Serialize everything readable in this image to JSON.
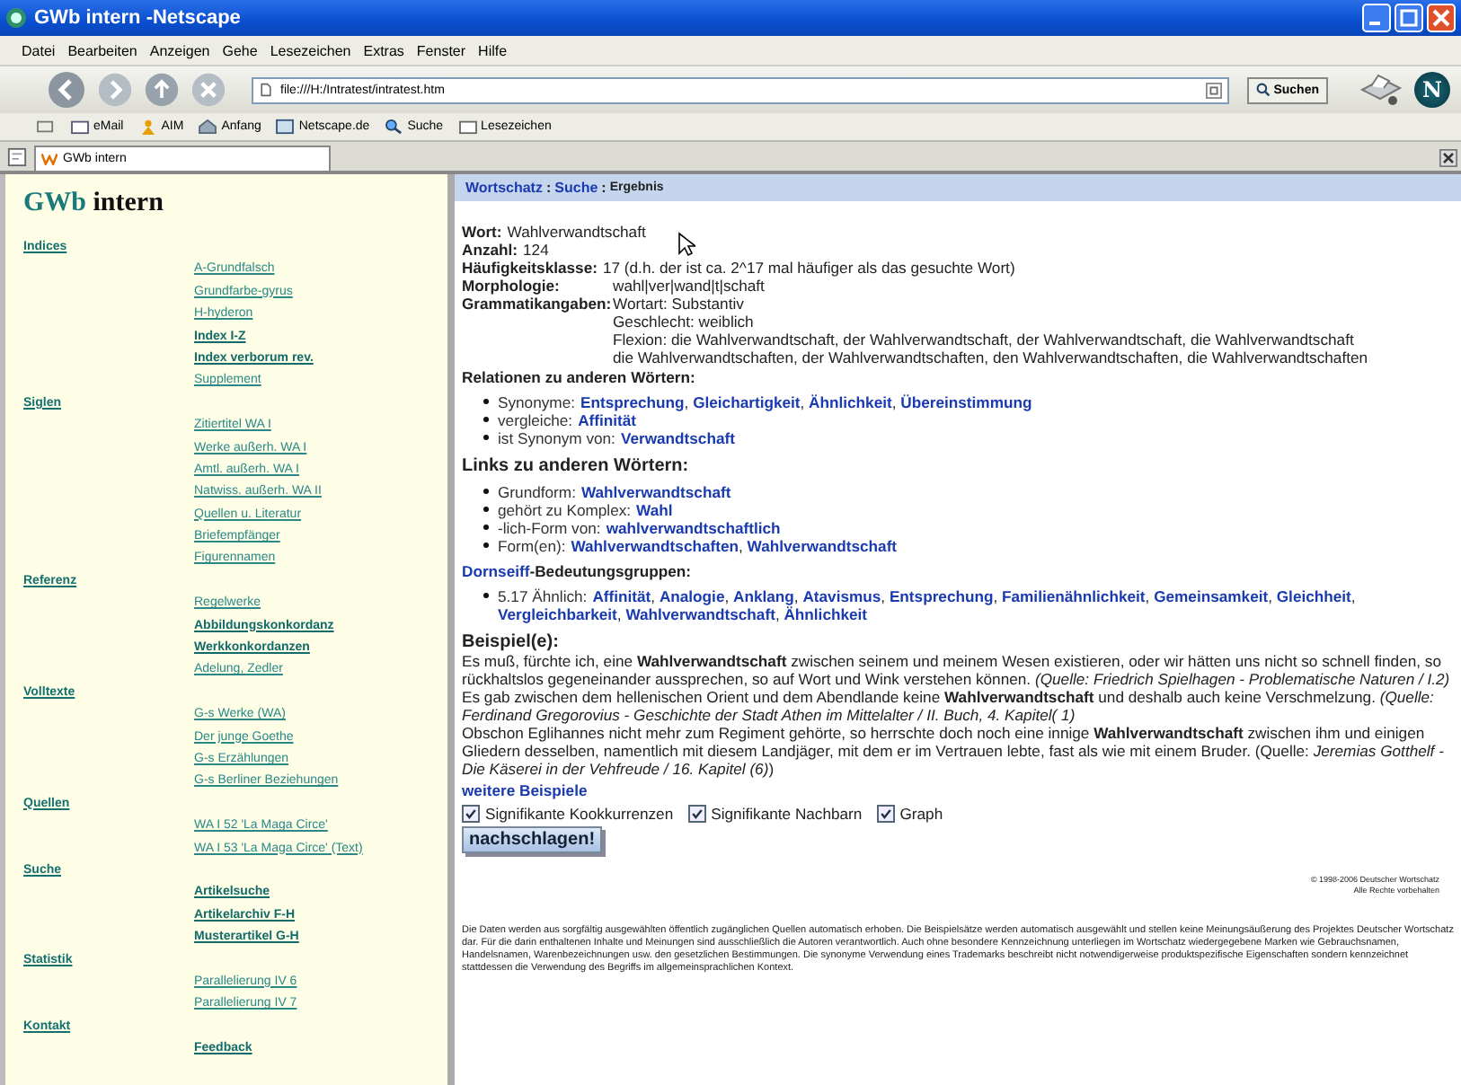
{
  "window": {
    "title": "GWb intern -Netscape"
  },
  "menu": [
    "Datei",
    "Bearbeiten",
    "Anzeigen",
    "Gehe",
    "Lesezeichen",
    "Extras",
    "Fenster",
    "Hilfe"
  ],
  "navigation": {
    "url": "file:///H:/Intratest/intratest.htm",
    "search_button": "Suchen",
    "logo_letter": "N"
  },
  "bookmarks": [
    {
      "label": "eMail",
      "kind": "mail"
    },
    {
      "label": "AIM",
      "kind": "person"
    },
    {
      "label": "Anfang",
      "kind": "home"
    },
    {
      "label": "Netscape.de",
      "kind": "page"
    },
    {
      "label": "Suche",
      "kind": "search"
    },
    {
      "label": "Lesezeichen",
      "kind": "folder"
    }
  ],
  "tab": {
    "label": "GWb intern"
  },
  "sidebar": {
    "logo_a": "GWb",
    "logo_b": "intern",
    "sections": [
      {
        "heading": "Indices",
        "links": [
          {
            "text": "A-Grundfalsch",
            "bold": false
          },
          {
            "text": "Grundfarbe-gyrus",
            "bold": false
          },
          {
            "text": "H-hyderon",
            "bold": false
          },
          {
            "text": "Index I-Z",
            "bold": true
          },
          {
            "text": "Index verborum rev.",
            "bold": true
          },
          {
            "text": "Supplement",
            "bold": false
          }
        ]
      },
      {
        "heading": "Siglen",
        "links": [
          {
            "text": "Zitiertitel WA I",
            "bold": false
          },
          {
            "text": "Werke außerh. WA I",
            "bold": false
          },
          {
            "text": "Amtl. außerh. WA I",
            "bold": false
          },
          {
            "text": "Natwiss. außerh. WA II",
            "bold": false
          },
          {
            "text": "Quellen u. Literatur",
            "bold": false
          },
          {
            "text": "Briefempfänger",
            "bold": false
          },
          {
            "text": "Figurennamen",
            "bold": false
          }
        ]
      },
      {
        "heading": "Referenz",
        "links": [
          {
            "text": "Regelwerke",
            "bold": false
          },
          {
            "text": "Abbildungskonkordanz",
            "bold": true
          },
          {
            "text": "Werkkonkordanzen",
            "bold": true
          },
          {
            "text": "Adelung, Zedler",
            "bold": false
          }
        ]
      },
      {
        "heading": "Volltexte",
        "links": [
          {
            "text": "G-s Werke (WA)",
            "bold": false
          },
          {
            "text": "Der junge Goethe",
            "bold": false
          },
          {
            "text": "G-s Erzählungen",
            "bold": false
          },
          {
            "text": "G-s Berliner Beziehungen",
            "bold": false
          }
        ]
      },
      {
        "heading": "Quellen",
        "links": [
          {
            "text": "WA I 52 'La Maga Circe'",
            "bold": false
          },
          {
            "text": "WA I 53 'La Maga Circe' (Text)",
            "bold": false
          }
        ]
      },
      {
        "heading": "Suche",
        "links": [
          {
            "text": "Artikelsuche",
            "bold": true
          },
          {
            "text": "Artikelarchiv F-H",
            "bold": true
          },
          {
            "text": "Musterartikel G-H",
            "bold": true
          }
        ]
      },
      {
        "heading": "Statistik",
        "links": [
          {
            "text": "Parallelierung IV 6",
            "bold": false
          },
          {
            "text": "Parallelierung IV 7",
            "bold": false
          }
        ]
      },
      {
        "heading": "Kontakt",
        "links": [
          {
            "text": "Feedback",
            "bold": true
          }
        ]
      }
    ]
  },
  "breadcrumb": {
    "separator": ":",
    "items": [
      {
        "label": "Wortschatz",
        "current": false
      },
      {
        "label": "Suche",
        "current": false
      },
      {
        "label": "Ergebnis",
        "current": true
      }
    ]
  },
  "word_info": [
    {
      "label": "Wort:",
      "kind": "inline",
      "values": [
        "Wahlverwandtschaft"
      ]
    },
    {
      "label": "Anzahl:",
      "kind": "inline",
      "values": [
        "124"
      ]
    },
    {
      "label": "Häufigkeitsklasse:",
      "kind": "inline",
      "values": [
        "17 (d.h. der ist ca. 2^17 mal häufiger als das gesuchte Wort)"
      ]
    },
    {
      "label": "Morphologie:",
      "kind": "column",
      "values": [
        "wahl|ver|wand|t|schaft"
      ]
    },
    {
      "label": "Grammatikangaben:",
      "kind": "column",
      "values": [
        "Wortart: Substantiv",
        "Geschlecht: weiblich",
        "Flexion: die Wahlverwandtschaft, der Wahlverwandtschaft, der Wahlverwandtschaft, die Wahlverwandtschaft",
        "die Wahlverwandtschaften, der Wahlverwandtschaften, den Wahlverwandtschaften, die Wahlverwandtschaften"
      ]
    }
  ],
  "link_separator": ",",
  "relations": {
    "heading": "Relationen zu anderen Wörtern:",
    "items": [
      {
        "label": "Synonyme:",
        "links": [
          "Entsprechung",
          "Gleichartigkeit",
          "Ähnlichkeit",
          "Übereinstimmung"
        ]
      },
      {
        "label": "vergleiche:",
        "links": [
          "Affinität"
        ]
      },
      {
        "label": "ist Synonym von:",
        "links": [
          "Verwandtschaft"
        ]
      }
    ]
  },
  "word_links": {
    "heading": "Links zu anderen Wörtern:",
    "items": [
      {
        "label": "Grundform:",
        "links": [
          "Wahlverwandtschaft"
        ]
      },
      {
        "label": "gehört zu Komplex:",
        "links": [
          "Wahl"
        ]
      },
      {
        "label": "-lich-Form von:",
        "links": [
          "wahlverwandtschaftlich"
        ]
      },
      {
        "label": "Form(en):",
        "links": [
          "Wahlverwandtschaften",
          "Wahlverwandtschaft"
        ]
      }
    ]
  },
  "dornseiff": {
    "link": "Dornseiff",
    "heading": "-Bedeutungsgruppen:",
    "items": [
      {
        "label": "5.17 Ähnlich:",
        "links": [
          "Affinität",
          "Analogie",
          "Anklang",
          "Atavismus",
          "Entsprechung",
          "Familienähnlichkeit",
          "Gemeinsamkeit",
          "Gleichheit",
          "Vergleichbarkeit",
          "Wahlverwandtschaft",
          "Ähnlichkeit"
        ]
      }
    ]
  },
  "examples": {
    "heading": "Beispiel(e):",
    "sentences": [
      "Es muß, fürchte ich, eine **Wahlverwandtschaft** zwischen seinem und meinem Wesen existieren, oder wir hätten uns nicht so schnell finden, so rückhaltslos gegeneinander aussprechen, so auf Wort und Wink verstehen können. *(Quelle: Friedrich Spielhagen - Problematische Naturen / I.2)*",
      "Es gab zwischen dem hellenischen Orient und dem Abendlande keine **Wahlverwandtschaft** und deshalb auch keine Verschmelzung. *(Quelle: Ferdinand Gregorovius - Geschichte der Stadt Athen im Mittelalter / II. Buch, 4. Kapitel( 1)*",
      "Obschon Eglihannes nicht mehr zum Regiment gehörte, so herrschte doch noch eine innige **Wahlverwandtschaft** zwischen ihm und einigen Gliedern desselben, namentlich mit diesem Landjäger, mit dem er im Vertrauen lebte, fast als wie mit einem Bruder. (Quelle: *Jeremias Gotthelf - Die Käserei in der Vehfreude / 16. Kapitel (6)*)"
    ],
    "more": "weitere Beispiele"
  },
  "options": [
    {
      "label": "Signifikante Kookkurrenzen",
      "checked": true
    },
    {
      "label": "Signifikante Nachbarn",
      "checked": true
    },
    {
      "label": "Graph",
      "checked": true
    }
  ],
  "submit": "nachschlagen!",
  "copyright": [
    "© 1998-2006 Deutscher Wortschatz",
    "Alle Rechte vorbehalten"
  ],
  "disclaimer": "Die Daten werden aus sorgfältig ausgewählten öffentlich zugänglichen Quellen automatisch erhoben. Die Beispielsätze werden automatisch ausgewählt und stellen keine Meinungsäußerung des Projektes Deutscher Wortschatz dar. Für die darin enthaltenen Inhalte und Meinungen sind ausschließlich die Autoren verantwortlich. Auch ohne besondere Kennzeichnung unterliegen im Wortschatz wiedergegebene Marken wie Gebrauchsnamen, Handelsnamen, Warenbezeichnungen usw. den gesetzlichen Bestimmungen. Die synonyme Verwendung eines Trademarks beschreibt nicht notwendigerweise produktspezifische Eigenschaften sondern kennzeichnet stattdessen die Verwendung des Begriffs im allgemeinsprachlichen Kontext."
}
